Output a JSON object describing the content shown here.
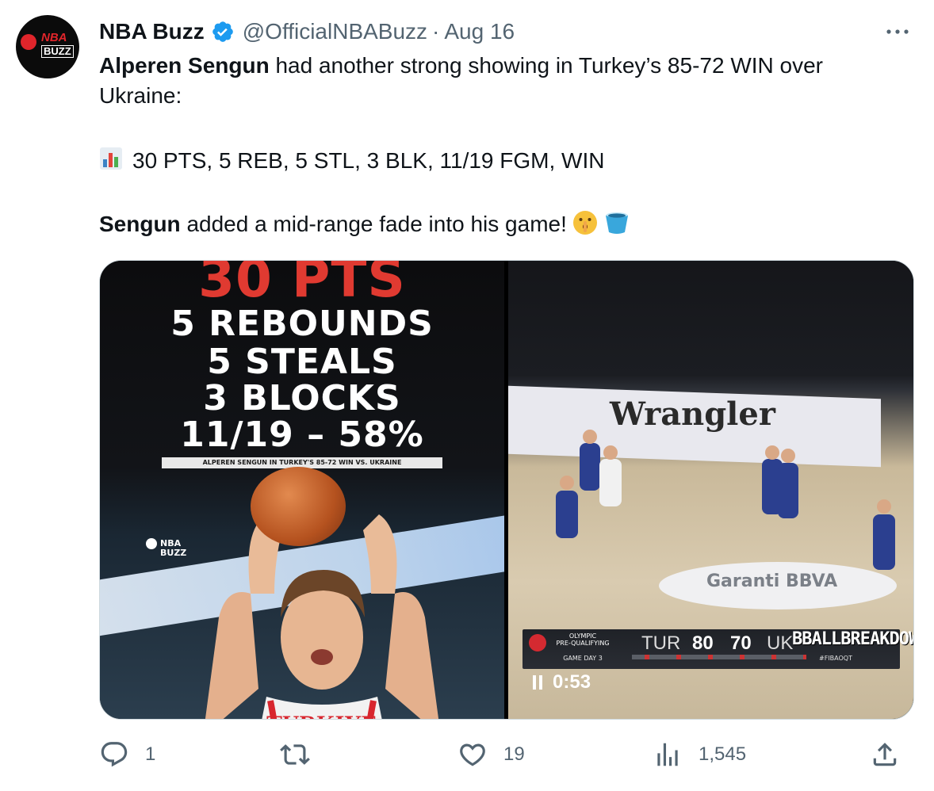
{
  "tweet": {
    "display_name": "NBA Buzz",
    "handle": "@OfficialNBABuzz",
    "separator": "·",
    "date": "Aug 16",
    "avatar_text_top": "NBA",
    "avatar_text_bottom": "BUZZ",
    "line1_bold": "Alperen Sengun",
    "line1_rest": " had another strong showing in Turkey’s 85-72 WIN over Ukraine:",
    "stats_line": "30 PTS, 5 REB, 5 STL, 3 BLK, 11/19 FGM, WIN",
    "line3_bold": "Sengun",
    "line3_rest": " added a mid-range fade into his game!",
    "more_label": "•••"
  },
  "media": {
    "left_image": {
      "headline_pts": "30 PTS",
      "reb": "5 REBOUNDS",
      "stl": "5 STEALS",
      "blk": "3 BLOCKS",
      "fg": "11/19 – 58%",
      "caption": "ALPEREN SENGUN IN TURKEY'S 85-72 WIN VS. UKRAINE",
      "watermark_top": "NBA",
      "watermark_bottom": "BUZZ",
      "jersey_text": "TURKIYE"
    },
    "right_video": {
      "adboard": "Wrangler",
      "floor_sponsor": "Garanti BBVA",
      "event_line1": "OLYMPIC",
      "event_line2": "PRE-QUALIFYING",
      "game_day": "GAME DAY 3",
      "team1": "TUR",
      "score1": "80",
      "score2": "70",
      "team2": "UK",
      "creator": "BBALLBREAKDOWN",
      "hashtag": "#FIBAOQT",
      "elapsed": "0:53"
    }
  },
  "actions": {
    "replies": "1",
    "retweets": "",
    "likes": "19",
    "views": "1,545"
  },
  "colors": {
    "text": "#0f1419",
    "secondary": "#536471",
    "verified": "#1d9bf0",
    "accent_red": "#e03a31",
    "border": "#cfd9de"
  },
  "icons": [
    "verified-badge-icon",
    "more-icon",
    "bar-chart-emoji",
    "shushing-face-emoji",
    "bucket-emoji",
    "reply-icon",
    "retweet-icon",
    "like-icon",
    "views-icon",
    "share-icon",
    "pause-icon"
  ]
}
